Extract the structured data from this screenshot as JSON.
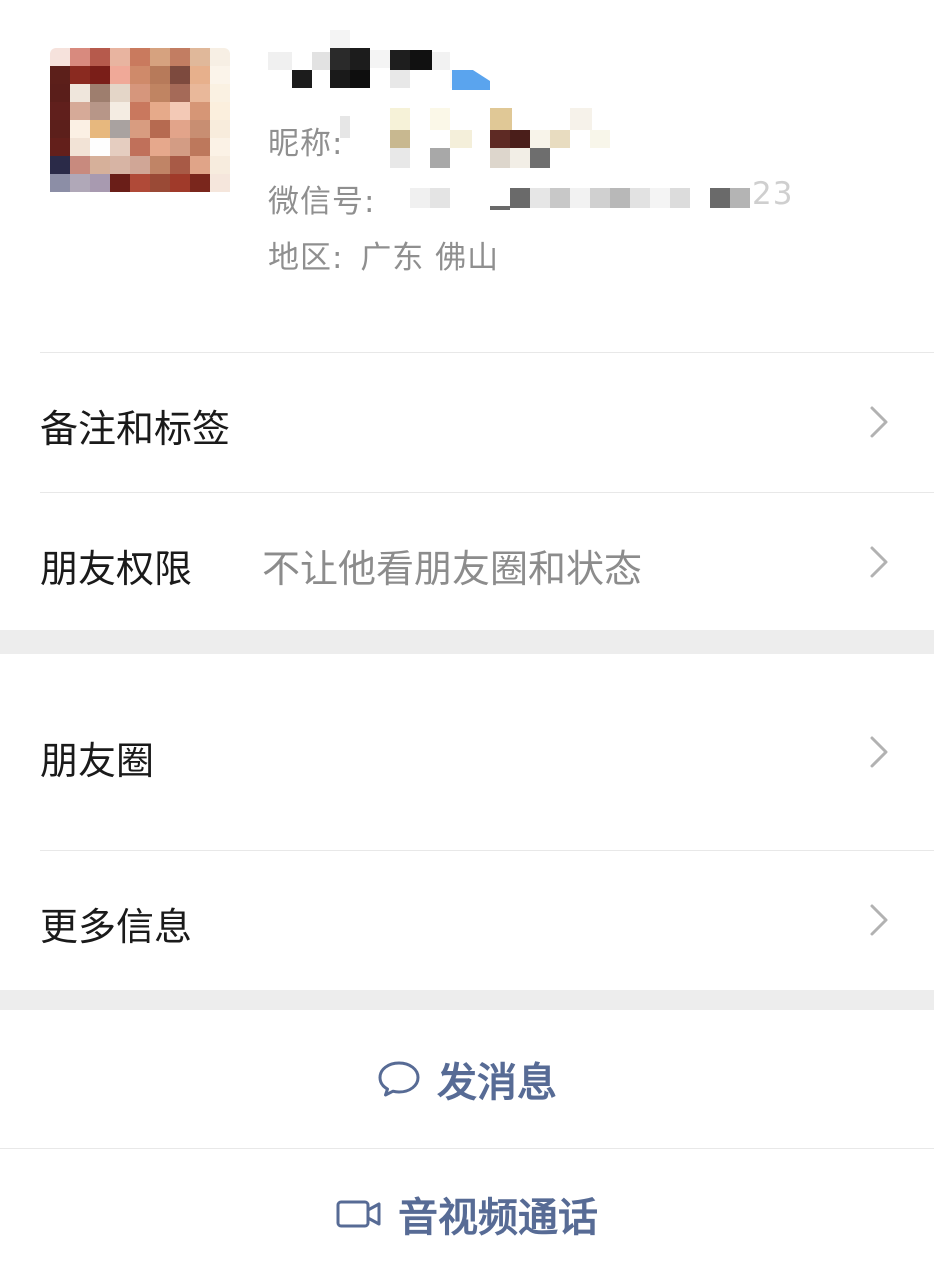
{
  "profile": {
    "nickname_label": "昵称:",
    "wechat_id_label": "微信号:",
    "wechat_id_tail": "23",
    "region_label": "地区:",
    "region_value": "广东 佛山"
  },
  "rows": {
    "remarks_tags": {
      "label": "备注和标签"
    },
    "friend_permissions": {
      "label": "朋友权限",
      "value": "不让他看朋友圈和状态"
    },
    "moments": {
      "label": "朋友圈"
    },
    "more_info": {
      "label": "更多信息"
    }
  },
  "actions": {
    "send_message": {
      "label": "发消息",
      "icon": "chat-bubble-icon"
    },
    "video_call": {
      "label": "音视频通话",
      "icon": "video-camera-icon"
    }
  },
  "colors": {
    "link_blue": "#576b95",
    "gap_gray": "#ededed",
    "verify_blue": "#5aa4ee"
  }
}
